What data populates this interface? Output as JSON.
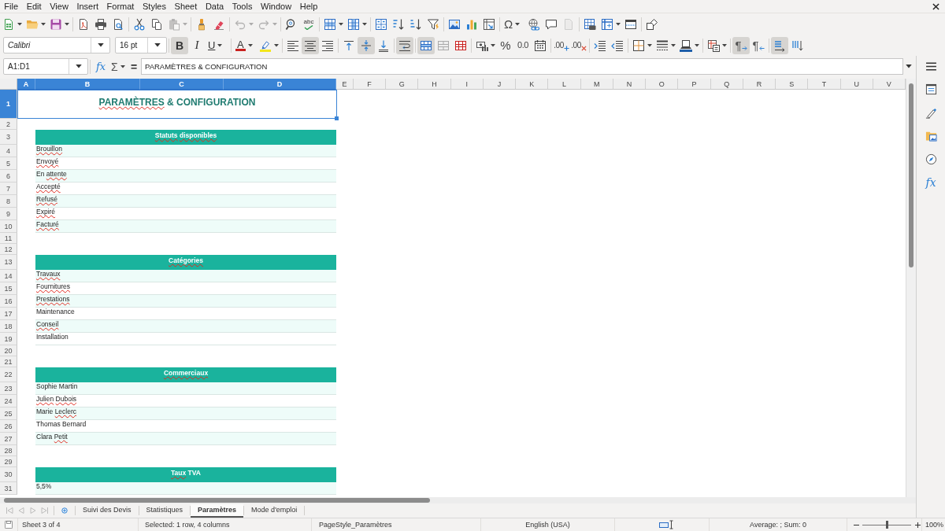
{
  "menu_bar": [
    "File",
    "Edit",
    "View",
    "Insert",
    "Format",
    "Styles",
    "Sheet",
    "Data",
    "Tools",
    "Window",
    "Help"
  ],
  "standard_toolbar": {
    "paste": {
      "disabled": true
    },
    "undo": {
      "disabled": true
    },
    "redo": {
      "disabled": true
    },
    "spelling": {
      "label": "abc"
    },
    "special_character": {
      "label": "Ω"
    },
    "headers_and_footers": {
      "disabled": true
    }
  },
  "formatting_toolbar": {
    "font_name": "Calibri",
    "font_size": "16 pt",
    "bold": {
      "label": "B",
      "pressed": true
    },
    "italic": {
      "label": "I",
      "pressed": false
    },
    "underline": {
      "label": "U",
      "pressed": false
    },
    "font_color": {
      "label": "A"
    },
    "align_left": {
      "pressed": false
    },
    "align_center": {
      "pressed": true
    },
    "align_right": {
      "pressed": false
    },
    "align_top": {
      "pressed": false
    },
    "center_vertically": {
      "pressed": true
    },
    "align_bottom": {
      "pressed": false
    },
    "wrap_text": {
      "pressed": true
    },
    "merge_and_center": {
      "pressed": true
    },
    "percent": {
      "label": "%"
    },
    "number_format": {
      "label": "0.0"
    },
    "add_decimal": {
      "label": ".00"
    },
    "delete_decimal": {
      "label": ".00"
    },
    "left_to_right": {
      "label": "¶",
      "pressed": true
    },
    "right_to_left": {
      "label": "¶",
      "pressed": false
    },
    "text_horizontal": {
      "pressed": true
    },
    "text_vertical": {
      "pressed": false
    }
  },
  "formula_bar": {
    "name_box": "A1:D1",
    "function_wizard_label": "fx",
    "sum_label": "Σ",
    "formula_label": "=",
    "content": "PARAMÈTRES & CONFIGURATION"
  },
  "column_headers": [
    {
      "label": "A",
      "selected": true
    },
    {
      "label": "B",
      "selected": true
    },
    {
      "label": "C",
      "selected": true
    },
    {
      "label": "D",
      "selected": true
    },
    {
      "label": "E",
      "selected": false
    },
    {
      "label": "F",
      "selected": false
    },
    {
      "label": "G",
      "selected": false
    },
    {
      "label": "H",
      "selected": false
    },
    {
      "label": "I",
      "selected": false
    },
    {
      "label": "J",
      "selected": false
    },
    {
      "label": "K",
      "selected": false
    },
    {
      "label": "L",
      "selected": false
    },
    {
      "label": "M",
      "selected": false
    },
    {
      "label": "N",
      "selected": false
    },
    {
      "label": "O",
      "selected": false
    },
    {
      "label": "P",
      "selected": false
    },
    {
      "label": "Q",
      "selected": false
    },
    {
      "label": "R",
      "selected": false
    },
    {
      "label": "S",
      "selected": false
    },
    {
      "label": "T",
      "selected": false
    },
    {
      "label": "U",
      "selected": false
    },
    {
      "label": "V",
      "selected": false
    }
  ],
  "rows": [
    {
      "number": "1",
      "selected": true,
      "kind": "title",
      "text": "PARAMÈTRES & CONFIGURATION",
      "misspelled": [
        true,
        false,
        false
      ]
    },
    {
      "number": "2",
      "selected": false,
      "kind": "blank"
    },
    {
      "number": "3",
      "selected": false,
      "kind": "header",
      "text": "Statuts disponibles",
      "misspelled": [
        true,
        true
      ]
    },
    {
      "number": "4",
      "selected": false,
      "kind": "item",
      "text": "Brouillon",
      "misspelled": [
        true
      ],
      "shaded": true
    },
    {
      "number": "5",
      "selected": false,
      "kind": "item",
      "text": "Envoyé",
      "misspelled": [
        true
      ],
      "shaded": false
    },
    {
      "number": "6",
      "selected": false,
      "kind": "item",
      "text": "En attente",
      "misspelled": [
        false,
        true
      ],
      "shaded": true
    },
    {
      "number": "7",
      "selected": false,
      "kind": "item",
      "text": "Accepté",
      "misspelled": [
        true
      ],
      "shaded": false
    },
    {
      "number": "8",
      "selected": false,
      "kind": "item",
      "text": "Refusé",
      "misspelled": [
        true
      ],
      "shaded": true
    },
    {
      "number": "9",
      "selected": false,
      "kind": "item",
      "text": "Expiré",
      "misspelled": [
        true
      ],
      "shaded": false
    },
    {
      "number": "10",
      "selected": false,
      "kind": "item",
      "text": "Facturé",
      "misspelled": [
        true
      ],
      "shaded": true
    },
    {
      "number": "11",
      "selected": false,
      "kind": "blank"
    },
    {
      "number": "12",
      "selected": false,
      "kind": "blank"
    },
    {
      "number": "13",
      "selected": false,
      "kind": "header",
      "text": "Catégories",
      "misspelled": [
        true
      ]
    },
    {
      "number": "14",
      "selected": false,
      "kind": "item",
      "text": "Travaux",
      "misspelled": [
        true
      ],
      "shaded": true
    },
    {
      "number": "15",
      "selected": false,
      "kind": "item",
      "text": "Fournitures",
      "misspelled": [
        true
      ],
      "shaded": false
    },
    {
      "number": "16",
      "selected": false,
      "kind": "item",
      "text": "Prestations",
      "misspelled": [
        true
      ],
      "shaded": true
    },
    {
      "number": "17",
      "selected": false,
      "kind": "item",
      "text": "Maintenance",
      "misspelled": [
        false
      ],
      "shaded": false
    },
    {
      "number": "18",
      "selected": false,
      "kind": "item",
      "text": "Conseil",
      "misspelled": [
        true
      ],
      "shaded": true
    },
    {
      "number": "19",
      "selected": false,
      "kind": "item",
      "text": "Installation",
      "misspelled": [
        false
      ],
      "shaded": false
    },
    {
      "number": "20",
      "selected": false,
      "kind": "blank"
    },
    {
      "number": "21",
      "selected": false,
      "kind": "blank"
    },
    {
      "number": "22",
      "selected": false,
      "kind": "header",
      "text": "Commerciaux",
      "misspelled": [
        true
      ]
    },
    {
      "number": "23",
      "selected": false,
      "kind": "item",
      "text": "Sophie Martin",
      "misspelled": [
        false,
        false
      ],
      "shaded": true
    },
    {
      "number": "24",
      "selected": false,
      "kind": "item",
      "text": "Julien Dubois",
      "misspelled": [
        true,
        true
      ],
      "shaded": false
    },
    {
      "number": "25",
      "selected": false,
      "kind": "item",
      "text": "Marie Leclerc",
      "misspelled": [
        false,
        true
      ],
      "shaded": true
    },
    {
      "number": "26",
      "selected": false,
      "kind": "item",
      "text": "Thomas Bernard",
      "misspelled": [
        false,
        false
      ],
      "shaded": false
    },
    {
      "number": "27",
      "selected": false,
      "kind": "item",
      "text": "Clara Petit",
      "misspelled": [
        false,
        true
      ],
      "shaded": true
    },
    {
      "number": "28",
      "selected": false,
      "kind": "blank"
    },
    {
      "number": "29",
      "selected": false,
      "kind": "blank"
    },
    {
      "number": "30",
      "selected": false,
      "kind": "header",
      "text": "Taux TVA",
      "misspelled": [
        true,
        false
      ]
    },
    {
      "number": "31",
      "selected": false,
      "kind": "item",
      "text": "5,5%",
      "misspelled": [
        false
      ],
      "shaded": true
    }
  ],
  "sheet_navigation": {
    "disabled": true
  },
  "sheet_tabs": [
    {
      "label": "Suivi des Devis",
      "selected": false
    },
    {
      "label": "Statistiques",
      "selected": false
    },
    {
      "label": "Paramètres",
      "selected": true
    },
    {
      "label": "Mode d'emploi",
      "selected": false
    }
  ],
  "status_bar": {
    "sheet_position": "Sheet 3 of 4",
    "selection": "Selected: 1 row, 4 columns",
    "page_style": "PageStyle_Paramètres",
    "language": "English (USA)",
    "summary": "Average: ; Sum: 0",
    "zoom_slider": {
      "level": 0.5
    },
    "zoom_percent": "100%"
  },
  "sidebar": {
    "functions_label": "fx"
  }
}
